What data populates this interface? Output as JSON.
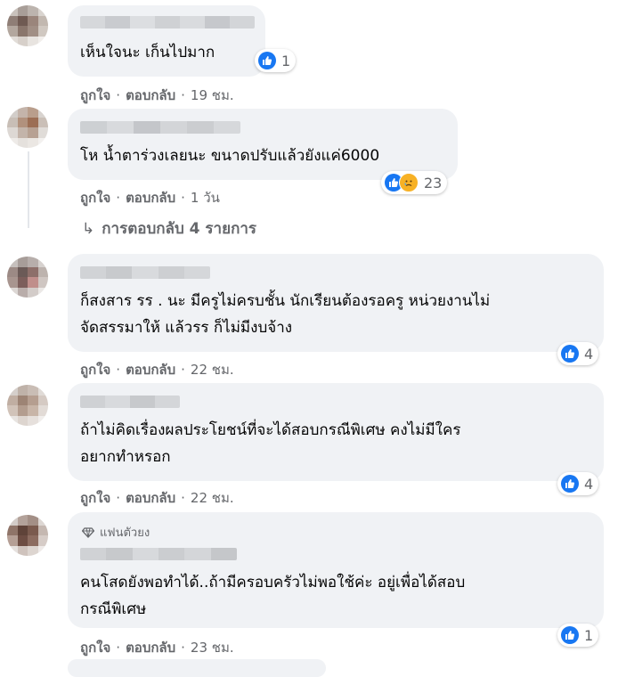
{
  "comments": [
    {
      "text_lines": [
        "เห็นใจนะ เก็นไปมาก"
      ],
      "like": "ถูกใจ",
      "reply": "ตอบกลับ",
      "time": "19 ชม.",
      "reaction_count": "1"
    },
    {
      "text_lines": [
        "โห น้ำตาร่วงเลยนะ ขนาดปรับแล้วยังแค่6000"
      ],
      "like": "ถูกใจ",
      "reply": "ตอบกลับ",
      "time": "1 วัน",
      "reaction_count": "23"
    },
    {
      "text_lines": [
        "ก็สงสาร รร . นะ มีครูไม่ครบชั้น นักเรียนต้องรอครู หน่วยงานไม่",
        "จัดสรรมาให้ แล้วรร ก็ไม่มีงบจ้าง"
      ],
      "like": "ถูกใจ",
      "reply": "ตอบกลับ",
      "time": "22 ชม.",
      "reaction_count": "4"
    },
    {
      "text_lines": [
        "ถ้าไม่คิดเรื่องผลประโยชน์ที่จะได้สอบกรณีพิเศษ คงไม่มีใคร",
        "อยากทำหรอก"
      ],
      "like": "ถูกใจ",
      "reply": "ตอบกลับ",
      "time": "22 ชม.",
      "reaction_count": "4"
    },
    {
      "badge": "แฟนตัวยง",
      "text_lines": [
        "คนโสดยังพอทำได้..ถ้ามีครอบครัวไม่พอใช้ค่ะ อยู่เพื่อได้สอบ",
        "กรณีพิเศษ"
      ],
      "like": "ถูกใจ",
      "reply": "ตอบกลับ",
      "time": "23 ชม.",
      "reaction_count": "1"
    }
  ],
  "replies_link": "การตอบกลับ 4 รายการ",
  "colors": {
    "bubble": "#f0f2f5",
    "meta": "#65676b",
    "like_blue": "#1877f2"
  }
}
